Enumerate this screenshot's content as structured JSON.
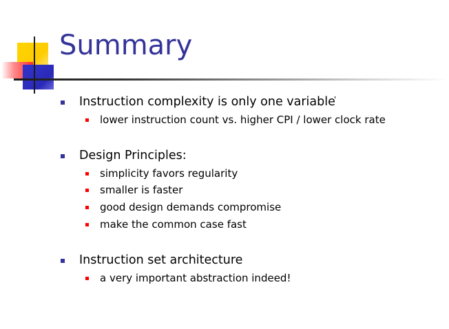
{
  "slide": {
    "title": "Summary",
    "sections": [
      {
        "heading": "Instruction complexity is only one variable",
        "items": [
          "lower instruction count vs. higher CPI / lower clock rate"
        ]
      },
      {
        "heading": "Design Principles:",
        "items": [
          "simplicity favors regularity",
          "smaller is faster",
          "good design demands compromise",
          "make the common case fast"
        ]
      },
      {
        "heading": "Instruction set architecture",
        "items": [
          "a very important abstraction indeed!"
        ]
      }
    ]
  },
  "colors": {
    "title": "#333399",
    "level1_bullet": "#333399",
    "level2_bullet": "#ff0000",
    "text": "#000000",
    "logo_yellow": "#ffcc00",
    "logo_red": "#ff2b2b",
    "logo_blue": "#3333cc"
  }
}
